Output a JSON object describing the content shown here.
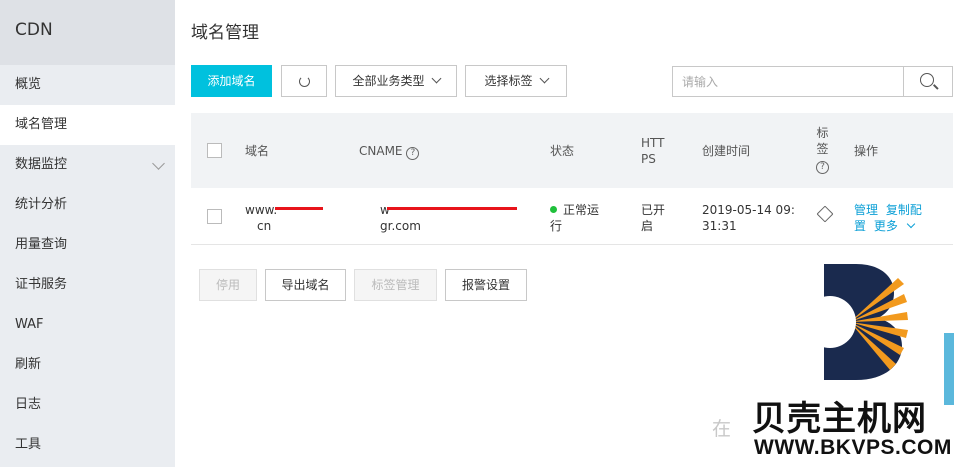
{
  "sidebar": {
    "title": "CDN",
    "items": [
      {
        "label": "概览"
      },
      {
        "label": "域名管理"
      },
      {
        "label": "数据监控"
      },
      {
        "label": "统计分析"
      },
      {
        "label": "用量查询"
      },
      {
        "label": "证书服务"
      },
      {
        "label": "WAF"
      },
      {
        "label": "刷新"
      },
      {
        "label": "日志"
      },
      {
        "label": "工具"
      }
    ]
  },
  "page": {
    "title": "域名管理"
  },
  "toolbar": {
    "add_label": "添加域名",
    "business_type_label": "全部业务类型",
    "tag_select_label": "选择标签"
  },
  "search": {
    "placeholder": "请输入"
  },
  "table": {
    "headers": {
      "domain": "域名",
      "cname": "CNAME",
      "status": "状态",
      "https_line1": "HTT",
      "https_line2": "PS",
      "created": "创建时间",
      "tag_line1": "标",
      "tag_line2": "签",
      "actions": "操作"
    },
    "rows": [
      {
        "domain_line1": "www.",
        "domain_line2": "cn",
        "cname_line1": "w",
        "cname_line2": "gr.com",
        "status_line1": "正常运",
        "status_line2": "行",
        "https_line1": "已开",
        "https_line2": "启",
        "created_line1": "2019-05-14 09:",
        "created_line2": "31:31",
        "action_manage": "管理",
        "action_copy_line1": "复制配",
        "action_copy_line2": "置",
        "action_more": "更多"
      }
    ]
  },
  "bottom_actions": {
    "disable_label": "停用",
    "export_label": "导出域名",
    "tag_manage_label": "标签管理",
    "alarm_label": "报警设置"
  },
  "watermark": {
    "brand": "贝壳主机网",
    "url": "WWW.BKVPS.COM",
    "faint": "在"
  },
  "colors": {
    "primary": "#00c1de",
    "link": "#0b9fd6",
    "status_ok": "#1fc03b",
    "redaction": "#e8141b"
  }
}
